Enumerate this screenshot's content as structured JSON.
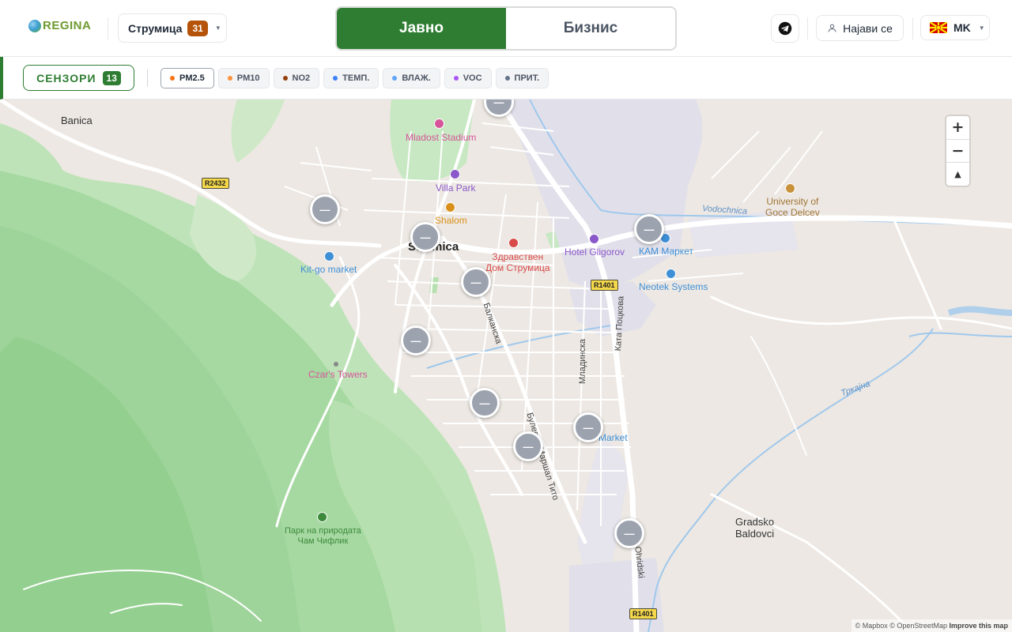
{
  "header": {
    "logo_text": "REGINA",
    "city": {
      "name": "Струмица",
      "count": "31"
    },
    "modes": [
      {
        "label": "Јавно",
        "active": true
      },
      {
        "label": "Бизнис",
        "active": false
      }
    ],
    "login_label": "Најави се",
    "language": "MK",
    "telegram_icon": "telegram-icon",
    "user_icon": "user-icon",
    "flag_icon": "north-macedonia-flag-icon"
  },
  "filters": {
    "sensors_label": "СЕНЗОРИ",
    "sensors_count": "13",
    "pills": [
      {
        "label": "PM2.5",
        "color": "#f97316",
        "active": true
      },
      {
        "label": "PM10",
        "color": "#fb923c",
        "active": false
      },
      {
        "label": "NO2",
        "color": "#92400e",
        "active": false
      },
      {
        "label": "ТЕМП.",
        "color": "#3b82f6",
        "active": false
      },
      {
        "label": "ВЛАЖ.",
        "color": "#60a5fa",
        "active": false
      },
      {
        "label": "VOC",
        "color": "#a855f7",
        "active": false
      },
      {
        "label": "ПРИТ.",
        "color": "#64748b",
        "active": false
      }
    ]
  },
  "map": {
    "places": {
      "banica": "Banica",
      "city": "Strumica",
      "gradsko": "Gradsko\nBaldovci",
      "mladost": "Mladost Stadium",
      "villa": "Villa Park",
      "shalom": "Shalom",
      "zdravstven": "Здравствен\nДом Струмица",
      "gligorov": "Hotel Gligorov",
      "kam": "КАМ Маркет",
      "neotek": "Neotek Systems",
      "kitgo": "Kit-go market",
      "czars": "Czar's Towers",
      "univ": "University of\nGoce Delcev",
      "park": "Парк на природата\nЧам Чифлик",
      "market2": "Market",
      "vodochnica": "Vodochnica",
      "trkajna": "Тркајна",
      "balkanska": "Балканска",
      "mladinska": "Младинска",
      "kata": "Ката Поцкова",
      "tito": "Булевар Маршал Тито",
      "ohridski": "Ohridski"
    },
    "roads": {
      "r2432": "R2432",
      "r1401a": "R1401",
      "r1401b": "R1401"
    },
    "marker_value": "—",
    "zoom_in": "+",
    "zoom_out": "−",
    "compass": "▲",
    "attribution": {
      "mapbox": "© Mapbox",
      "osm": "© OpenStreetMap",
      "improve": "Improve this map"
    }
  }
}
